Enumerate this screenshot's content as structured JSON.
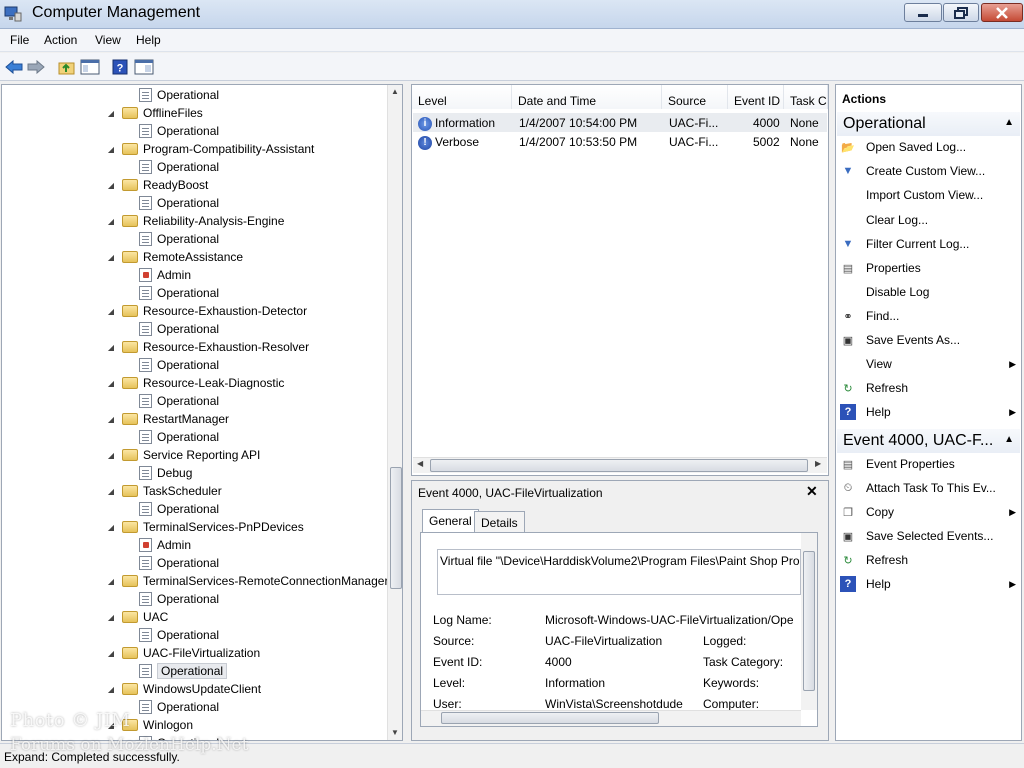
{
  "window": {
    "title": "Computer Management"
  },
  "menu": [
    "File",
    "Action",
    "View",
    "Help"
  ],
  "toolbar": [
    "back-icon",
    "forward-icon",
    "up-folder-icon",
    "show-hide-tree-icon",
    "help-icon",
    "show-hide-action-pane-icon"
  ],
  "tree": [
    {
      "label": "Operational",
      "type": "log"
    },
    {
      "label": "OfflineFiles",
      "type": "folder"
    },
    {
      "label": "Operational",
      "type": "log"
    },
    {
      "label": "Program-Compatibility-Assistant",
      "type": "folder"
    },
    {
      "label": "Operational",
      "type": "log"
    },
    {
      "label": "ReadyBoost",
      "type": "folder"
    },
    {
      "label": "Operational",
      "type": "log"
    },
    {
      "label": "Reliability-Analysis-Engine",
      "type": "folder"
    },
    {
      "label": "Operational",
      "type": "log"
    },
    {
      "label": "RemoteAssistance",
      "type": "folder"
    },
    {
      "label": "Admin",
      "type": "admin"
    },
    {
      "label": "Operational",
      "type": "log"
    },
    {
      "label": "Resource-Exhaustion-Detector",
      "type": "folder"
    },
    {
      "label": "Operational",
      "type": "log"
    },
    {
      "label": "Resource-Exhaustion-Resolver",
      "type": "folder"
    },
    {
      "label": "Operational",
      "type": "log"
    },
    {
      "label": "Resource-Leak-Diagnostic",
      "type": "folder"
    },
    {
      "label": "Operational",
      "type": "log"
    },
    {
      "label": "RestartManager",
      "type": "folder"
    },
    {
      "label": "Operational",
      "type": "log"
    },
    {
      "label": "Service Reporting API",
      "type": "folder"
    },
    {
      "label": "Debug",
      "type": "log"
    },
    {
      "label": "TaskScheduler",
      "type": "folder"
    },
    {
      "label": "Operational",
      "type": "log"
    },
    {
      "label": "TerminalServices-PnPDevices",
      "type": "folder"
    },
    {
      "label": "Admin",
      "type": "admin"
    },
    {
      "label": "Operational",
      "type": "log"
    },
    {
      "label": "TerminalServices-RemoteConnectionManager",
      "type": "folder"
    },
    {
      "label": "Operational",
      "type": "log"
    },
    {
      "label": "UAC",
      "type": "folder"
    },
    {
      "label": "Operational",
      "type": "log"
    },
    {
      "label": "UAC-FileVirtualization",
      "type": "folder"
    },
    {
      "label": "Operational",
      "type": "log",
      "selected": true
    },
    {
      "label": "WindowsUpdateClient",
      "type": "folder"
    },
    {
      "label": "Operational",
      "type": "log"
    },
    {
      "label": "Winlogon",
      "type": "folder"
    },
    {
      "label": "Operational",
      "type": "log"
    }
  ],
  "events": {
    "columns": [
      "Level",
      "Date and Time",
      "Source",
      "Event ID",
      "Task C..."
    ],
    "rows": [
      {
        "level": "Information",
        "datetime": "1/4/2007 10:54:00 PM",
        "source": "UAC-Fi...",
        "event_id": "4000",
        "task": "None",
        "icon": "information-icon"
      },
      {
        "level": "Verbose",
        "datetime": "1/4/2007 10:53:50 PM",
        "source": "UAC-Fi...",
        "event_id": "5002",
        "task": "None",
        "icon": "verbose-icon"
      }
    ]
  },
  "detail": {
    "title": "Event 4000, UAC-FileVirtualization",
    "tabs": [
      "General",
      "Details"
    ],
    "description": "Virtual file \"\\Device\\HarddiskVolume2\\Program Files\\Paint Shop Pro",
    "fields": [
      {
        "label": "Log Name:",
        "value": "Microsoft-Windows-UAC-FileVirtualization/Ope"
      },
      {
        "label": "Source:",
        "value": "UAC-FileVirtualization",
        "label2": "Logged:",
        "value2": ""
      },
      {
        "label": "Event ID:",
        "value": "4000",
        "label2": "Task Category:",
        "value2": ""
      },
      {
        "label": "Level:",
        "value": "Information",
        "label2": "Keywords:",
        "value2": ""
      },
      {
        "label": "User:",
        "value": "WinVista\\Screenshotdude",
        "label2": "Computer:",
        "value2": ""
      }
    ]
  },
  "actions": {
    "title": "Actions",
    "sections": [
      {
        "header": "Operational",
        "items": [
          {
            "label": "Open Saved Log...",
            "icon": "open-log-icon"
          },
          {
            "label": "Create Custom View...",
            "icon": "filter-icon"
          },
          {
            "label": "Import Custom View...",
            "icon": ""
          },
          {
            "label": "Clear Log...",
            "icon": ""
          },
          {
            "label": "Filter Current Log...",
            "icon": "filter-icon"
          },
          {
            "label": "Properties",
            "icon": "properties-icon"
          },
          {
            "label": "Disable Log",
            "icon": ""
          },
          {
            "label": "Find...",
            "icon": "binoculars-icon"
          },
          {
            "label": "Save Events As...",
            "icon": "save-icon"
          },
          {
            "label": "View",
            "icon": "",
            "submenu": true
          },
          {
            "label": "Refresh",
            "icon": "refresh-icon"
          },
          {
            "label": "Help",
            "icon": "help-icon",
            "submenu": true
          }
        ]
      },
      {
        "header": "Event 4000, UAC-F...",
        "items": [
          {
            "label": "Event Properties",
            "icon": "properties-icon"
          },
          {
            "label": "Attach Task To This Ev...",
            "icon": "task-icon"
          },
          {
            "label": "Copy",
            "icon": "copy-icon",
            "submenu": true
          },
          {
            "label": "Save Selected Events...",
            "icon": "save-icon"
          },
          {
            "label": "Refresh",
            "icon": "refresh-icon"
          },
          {
            "label": "Help",
            "icon": "help-icon",
            "submenu": true
          }
        ]
      }
    ]
  },
  "status": "Expand:  Completed successfully.",
  "watermark": [
    "Photo © JIM",
    "Forums on MozlenHelp.Net"
  ]
}
